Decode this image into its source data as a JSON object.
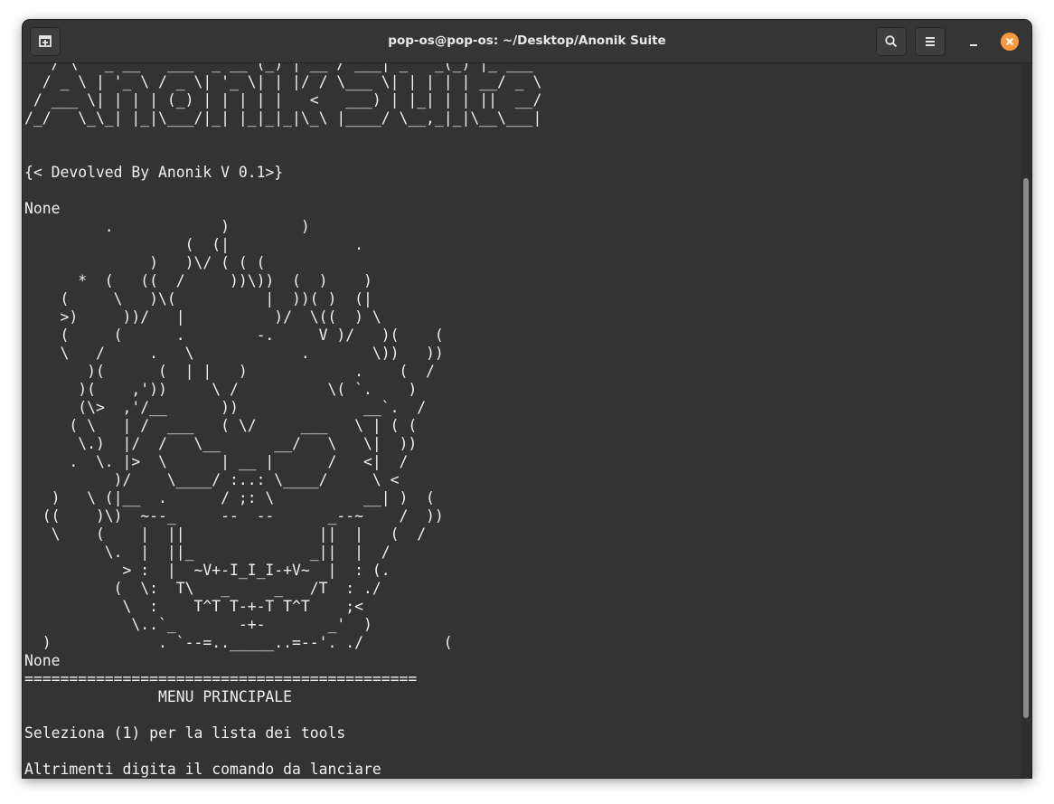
{
  "window": {
    "title": "pop-os@pop-os: ~/Desktop/Anonik Suite"
  },
  "header": {
    "new_tab_icon": "new-tab-icon",
    "search_icon": "search-icon",
    "menu_icon": "hamburger-menu-icon",
    "minimize_icon": "minimize-icon",
    "close_icon": "close-icon",
    "close_color": "#f79a3c"
  },
  "terminal": {
    "lines": [
      "   / \\   _ __   ___  _ __ (_) | __ / ___| _   _(_) |_ ___",
      "  / _ \\ | '_ \\ / _ \\| '_ \\| | |/ / \\___ \\| | | | | __/ _ \\",
      " / ___ \\| | | | (_) | | | | |   <   ___) | |_| | | ||  __/",
      "/_/   \\_\\_| |_|\\___/|_| |_|_|_|\\_\\ |____/ \\__,_|_|\\__\\___|",
      "",
      "",
      "{< Devolved By Anonik V 0.1>}",
      "",
      "None",
      "         .            )        )",
      "                  (  (|              .",
      "              )   )\\/ ( ( (",
      "      *  (   ((  /     ))\\))  (  )    )",
      "    (     \\   )\\(          |  ))( )  (|",
      "    >)     ))/   |          )/  \\((  ) \\",
      "    (     (      .        -.     V )/   )(    (",
      "    \\   /     .   \\            .       \\))   ))",
      "       )(      (  | |   )            .    (  /",
      "      )(    ,'))     \\ /          \\( `.    )",
      "      (\\>  ,'/__      ))              __`.  /",
      "     ( \\   | /  ___   ( \\/     ___   \\ | ( (",
      "      \\.)  |/  /   \\__      __/   \\   \\|  ))",
      "     .  \\. |>  \\      | __ |      /   <|  /",
      "          )/    \\____/ :..: \\____/     \\ <",
      "   )   \\ (|__  .      / ;: \\          __| )  (",
      "  ((    )\\)  ~--_     --  --      _--~    /  ))",
      "   \\    (    |  ||               ||  |   (  /",
      "         \\.  |  ||_             _||  |  /",
      "           > :  |  ~V+-I_I_I-+V~  |  : (.",
      "          (  \\:  T\\   _     _   /T  : ./",
      "           \\  :    T^T T-+-T T^T    ;<",
      "            \\..`_       -+-       _'  )",
      "  )            . `--=.._____..=--'. ./         (",
      "None",
      "============================================",
      "               MENU PRINCIPALE",
      "",
      "Seleziona (1) per la lista dei tools",
      "",
      "Altrimenti digita il comando da lanciare"
    ]
  }
}
